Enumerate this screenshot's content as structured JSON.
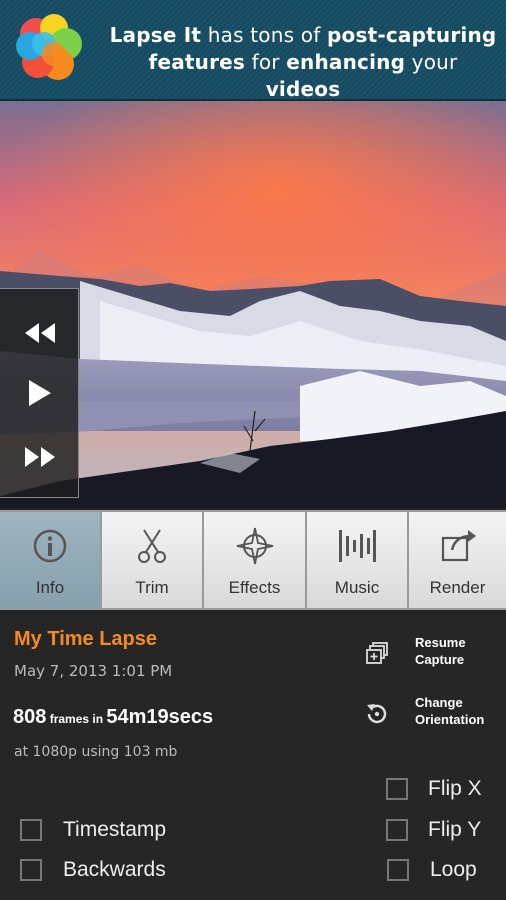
{
  "banner": {
    "line1_a": "Lapse It",
    "line1_b": " has tons of ",
    "line1_c": "post-capturing",
    "line2_a": "features",
    "line2_b": " for ",
    "line2_c": "enhancing",
    "line2_d": " your ",
    "line2_e": "videos",
    "logo_icon": "lapse-it-logo"
  },
  "playback": {
    "rewind_icon": "rewind-icon",
    "play_icon": "play-icon",
    "forward_icon": "fast-forward-icon"
  },
  "tabs": [
    {
      "label": "Info",
      "icon": "info-icon",
      "active": true
    },
    {
      "label": "Trim",
      "icon": "scissors-icon",
      "active": false
    },
    {
      "label": "Effects",
      "icon": "effects-icon",
      "active": false
    },
    {
      "label": "Music",
      "icon": "music-icon",
      "active": false
    },
    {
      "label": "Render",
      "icon": "share-icon",
      "active": false
    }
  ],
  "info": {
    "title": "My Time Lapse",
    "date": "May 7, 2013 1:01 PM",
    "frame_count": "808",
    "frames_in": " frames in ",
    "duration": "54m19secs",
    "meta": "at 1080p using 103 mb"
  },
  "actions": {
    "resume_line1": "Resume",
    "resume_line2": "Capture",
    "orient_line1": "Change",
    "orient_line2": "Orientation"
  },
  "options": {
    "flip_x": "Flip X",
    "flip_y": "Flip Y",
    "loop": "Loop",
    "timestamp": "Timestamp",
    "backwards": "Backwards"
  },
  "colors": {
    "accent": "#f58b1f",
    "banner_bg": "#17495f",
    "active_tab": "#8fa8b5"
  }
}
